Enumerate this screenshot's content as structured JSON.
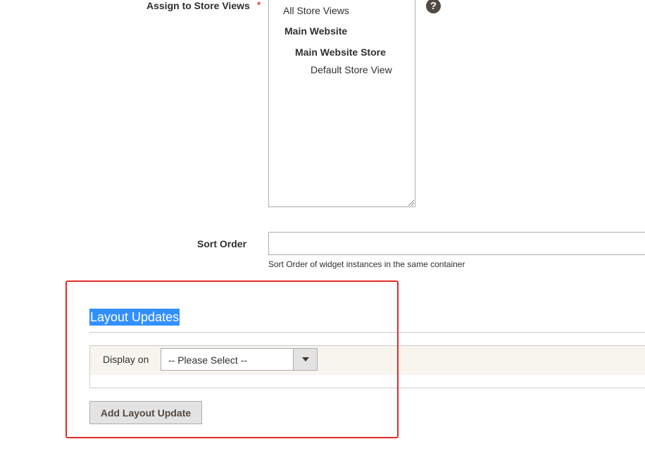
{
  "store_views": {
    "label": "Assign to Store Views",
    "required_mark": "*",
    "help_glyph": "?",
    "options": [
      {
        "label": "All Store Views",
        "bold": false
      },
      {
        "label": "Main Website",
        "bold": true
      },
      {
        "label": "Main Website Store",
        "bold": true
      },
      {
        "label": "Default Store View",
        "bold": false
      }
    ]
  },
  "sort_order": {
    "label": "Sort Order",
    "value": "",
    "note": "Sort Order of widget instances in the same container"
  },
  "layout_updates": {
    "title": "Layout Updates",
    "display_on_label": "Display on",
    "select_value": "-- Please Select --",
    "add_button_label": "Add Layout Update"
  },
  "colors": {
    "required": "#e22626",
    "selection_highlight": "#3390ff",
    "annotation_frame": "#e02b27",
    "row_background": "#f8f5ef",
    "button_background": "#e3e3e3"
  },
  "icons": {
    "help": "help-icon",
    "dropdown": "chevron-down-icon",
    "resize": "resize-grip-icon"
  }
}
